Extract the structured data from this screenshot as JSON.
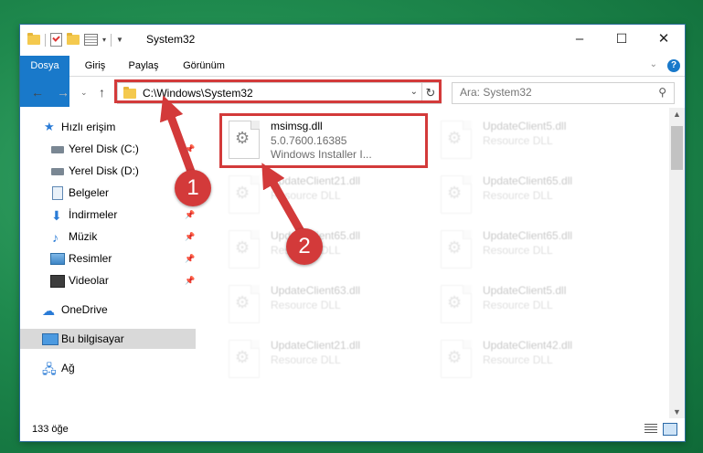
{
  "window": {
    "title": "System32",
    "controls": {
      "minimize": "–",
      "maximize": "☐",
      "close": "✕"
    }
  },
  "ribbon": {
    "tabs": [
      "Dosya",
      "Giriş",
      "Paylaş",
      "Görünüm"
    ],
    "help": "?"
  },
  "nav": {
    "address": "C:\\Windows\\System32",
    "search_placeholder": "Ara: System32"
  },
  "sidebar": {
    "items": [
      {
        "label": "Hızlı erişim"
      },
      {
        "label": "Yerel Disk (C:)"
      },
      {
        "label": "Yerel Disk (D:)"
      },
      {
        "label": "Belgeler"
      },
      {
        "label": "İndirmeler"
      },
      {
        "label": "Müzik"
      },
      {
        "label": "Resimler"
      },
      {
        "label": "Videolar"
      },
      {
        "label": "OneDrive"
      },
      {
        "label": "Bu bilgisayar"
      },
      {
        "label": "Ağ"
      }
    ],
    "selected": "Bu bilgisayar"
  },
  "files": [
    {
      "name": "msimsg.dll",
      "version": "5.0.7600.16385",
      "type": "Windows Installer I..."
    },
    {
      "name": "UpdateClient5.dll",
      "type": "Resource DLL"
    },
    {
      "name": "UpdateClient21.dll",
      "type": "Resource DLL"
    },
    {
      "name": "UpdateClient65.dll",
      "type": "Resource DLL"
    },
    {
      "name": "UpdateClient65.dll",
      "type": "Resource DLL"
    },
    {
      "name": "UpdateClient65.dll",
      "type": "Resource DLL"
    },
    {
      "name": "UpdateClient63.dll",
      "type": "Resource DLL"
    },
    {
      "name": "UpdateClient5.dll",
      "type": "Resource DLL"
    },
    {
      "name": "UpdateClient21.dll",
      "type": "Resource DLL"
    },
    {
      "name": "UpdateClient42.dll",
      "type": "Resource DLL"
    }
  ],
  "status": {
    "count": "133 öğe"
  },
  "annotations": {
    "badge1": "1",
    "badge2": "2",
    "color": "#d33a3a"
  }
}
